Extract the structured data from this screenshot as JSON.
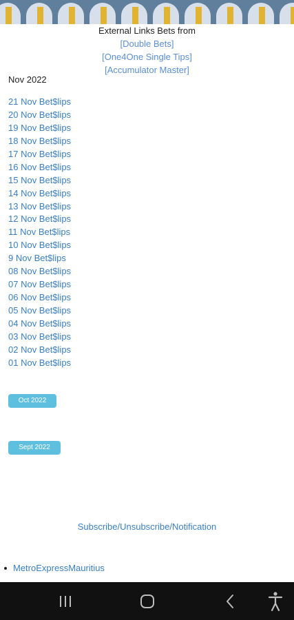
{
  "header": {
    "title": "External Links Bets from",
    "links": [
      "[Double Bets]",
      "[One4One Single Tips]",
      "[Accumulator Master]"
    ]
  },
  "month": {
    "title": "Nov 2022",
    "items": [
      "21 Nov Bet$lips",
      "20 Nov Bet$lips",
      "19 Nov Bet$lips",
      "18 Nov Bet$lips",
      "17 Nov Bet$lips",
      "16 Nov Bet$lips",
      "15 Nov Bet$lips",
      "14 Nov Bet$lips",
      "13 Nov Bet$lips",
      "12 Nov Bet$lips",
      "11 Nov Bet$lips",
      "10 Nov Bet$lips",
      "9 Nov Bet$lips",
      "08 Nov Bet$lips",
      "07 Nov Bet$lips",
      "06 Nov Bet$lips",
      "05 Nov Bet$lips",
      "04 Nov Bet$lips",
      "03 Nov Bet$lips",
      "02 Nov Bet$lips",
      "01 Nov Bet$lips"
    ]
  },
  "archive": {
    "oct_label": "Oct 2022",
    "sept_label": "Sept 2022"
  },
  "subscribe_label": "Subscribe/Unsubscribe/Notification",
  "bullets": [
    "MetroExpressMauritius"
  ],
  "colors": {
    "link": "#3a7fbf",
    "button": "#5fbfdf",
    "navbar": "#111111"
  },
  "navbar": {
    "icons": [
      "recent-apps-icon",
      "home-icon",
      "back-icon",
      "accessibility-icon"
    ]
  }
}
